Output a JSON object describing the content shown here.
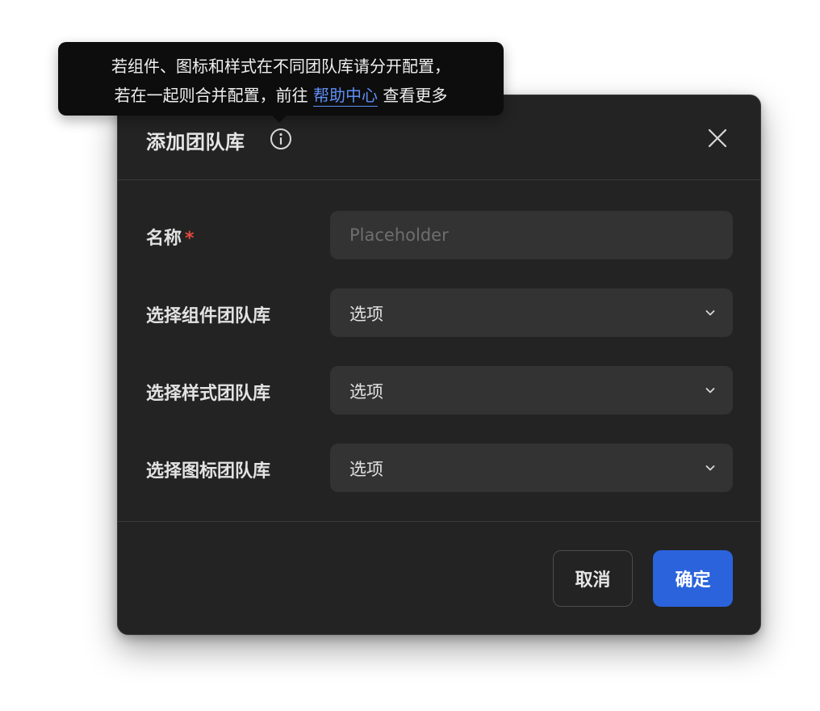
{
  "tooltip": {
    "line1": "若组件、图标和样式在不同团队库请分开配置，",
    "line2_before": "若在一起则合并配置，前往 ",
    "link": "帮助中心",
    "line2_after": " 查看更多"
  },
  "modal": {
    "title": "添加团队库",
    "info_icon": "info-circle-icon",
    "close_icon": "close-icon"
  },
  "form": {
    "name": {
      "label": "名称",
      "required_mark": "*",
      "placeholder": "Placeholder",
      "value": ""
    },
    "component_library": {
      "label": "选择组件团队库",
      "value": "选项"
    },
    "style_library": {
      "label": "选择样式团队库",
      "value": "选项"
    },
    "icon_library": {
      "label": "选择图标团队库",
      "value": "选项"
    }
  },
  "footer": {
    "cancel_label": "取消",
    "confirm_label": "确定"
  },
  "colors": {
    "modal_bg": "#232323",
    "field_bg": "#333333",
    "accent": "#2b63dc",
    "link": "#5e8ff5",
    "required": "#e5483d",
    "tooltip_bg": "#0d0d0d"
  }
}
